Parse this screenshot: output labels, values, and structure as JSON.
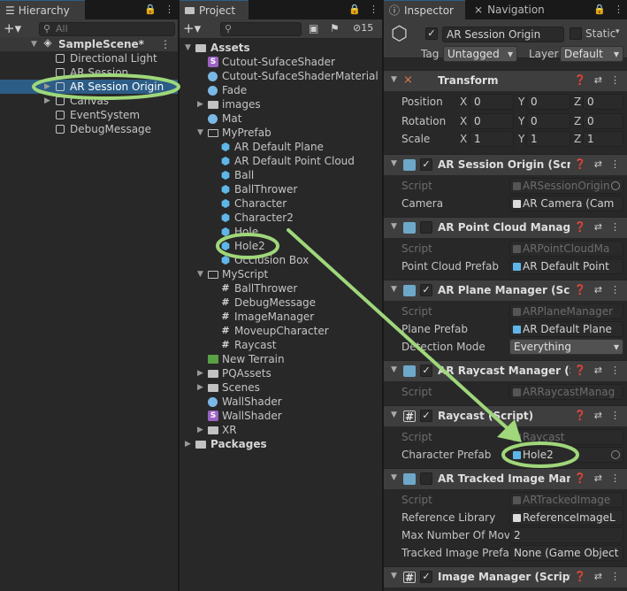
{
  "hierarchy": {
    "tab": "Hierarchy",
    "search_placeholder": "All",
    "scene": "SampleScene*",
    "items": [
      "Directional Light",
      "AR Session",
      "AR Session Origin",
      "Canvas",
      "EventSystem",
      "DebugMessage"
    ]
  },
  "project": {
    "tab": "Project",
    "count": "15",
    "assets": "Assets",
    "cutout_shader": "Cutout-SufaceShader",
    "cutout_material": "Cutout-SufaceShaderMaterial",
    "fade": "Fade",
    "images": "images",
    "mat": "Mat",
    "myprefab": "MyPrefab",
    "prefabs": [
      "AR Default Plane",
      "AR Default Point Cloud",
      "Ball",
      "BallThrower",
      "Character",
      "Character2",
      "Hole",
      "Hole2",
      "Occlusion Box"
    ],
    "myscript": "MyScript",
    "scripts": [
      "BallThrower",
      "DebugMessage",
      "ImageManager",
      "MoveupCharacter",
      "Raycast"
    ],
    "new_terrain": "New Terrain",
    "pqassets": "PQAssets",
    "scenes": "Scenes",
    "wallshader_mat": "WallShader",
    "wallshader_shader": "WallShader",
    "xr": "XR",
    "packages": "Packages"
  },
  "inspector": {
    "tab": "Inspector",
    "nav_tab": "Navigation",
    "object_name": "AR Session Origin",
    "static_label": "Static",
    "tag_label": "Tag",
    "tag_value": "Untagged",
    "layer_label": "Layer",
    "layer_value": "Default",
    "transform": {
      "title": "Transform",
      "position": "Position",
      "rotation": "Rotation",
      "scale": "Scale",
      "x": "X",
      "y": "Y",
      "z": "Z",
      "pos": [
        "0",
        "0",
        "0"
      ],
      "rot": [
        "0",
        "0",
        "0"
      ],
      "scl": [
        "1",
        "1",
        "1"
      ]
    },
    "script_label": "Script",
    "session_origin": {
      "title": "AR Session Origin (Script)",
      "script": "ARSessionOrigin",
      "camera_label": "Camera",
      "camera_value": "AR Camera (Cam"
    },
    "point_cloud": {
      "title": "AR Point Cloud Manager (",
      "script": "ARPointCloudMa",
      "prefab_label": "Point Cloud Prefab",
      "prefab_value": "AR Default Point"
    },
    "plane": {
      "title": "AR Plane Manager (Script",
      "script": "ARPlaneManager",
      "prefab_label": "Plane Prefab",
      "prefab_value": "AR Default Plane",
      "mode_label": "Detection Mode",
      "mode_value": "Everything"
    },
    "raycast_mgr": {
      "title": "AR Raycast Manager (Scr",
      "script": "ARRaycastManag"
    },
    "raycast": {
      "title": "Raycast (Script)",
      "script": "Raycast",
      "char_label": "Character Prefab",
      "char_value": "Hole2"
    },
    "tracked": {
      "title": "AR Tracked Image Manag",
      "script": "ARTrackedImage",
      "lib_label": "Reference Library",
      "lib_value": "ReferenceImageL",
      "max_label": "Max Number Of Movi",
      "max_value": "2",
      "prefab_label": "Tracked Image Prefal",
      "prefab_value": "None (Game Object"
    },
    "image_mgr": {
      "title": "Image Manager (Script)"
    }
  },
  "colors": {
    "annotation": "#9fd77a",
    "selection": "#2c5d87"
  }
}
